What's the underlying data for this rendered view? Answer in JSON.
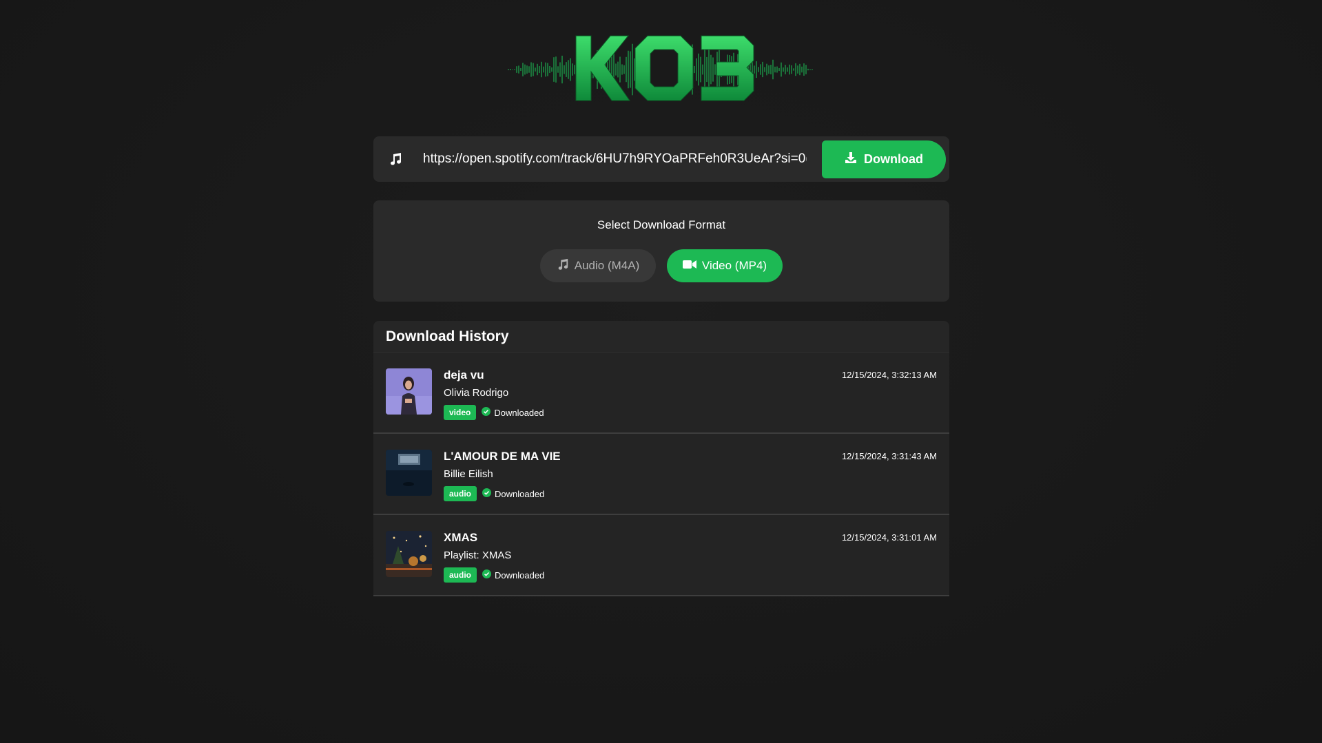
{
  "logo": {
    "text": "KO3",
    "color": "#1db954"
  },
  "search": {
    "icon": "music-note-icon",
    "value": "https://open.spotify.com/track/6HU7h9RYOaPRFeh0R3UeAr?si=0(",
    "button_label": "Download",
    "button_icon": "download-icon"
  },
  "format": {
    "title": "Select Download Format",
    "options": [
      {
        "label": "Audio (M4A)",
        "icon": "music-note-icon",
        "selected": false
      },
      {
        "label": "Video (MP4)",
        "icon": "video-camera-icon",
        "selected": true
      }
    ]
  },
  "history": {
    "title": "Download History",
    "items": [
      {
        "title": "deja vu",
        "subtitle": "Olivia Rodrigo",
        "type": "video",
        "status": "Downloaded",
        "time": "12/15/2024, 3:32:13 AM"
      },
      {
        "title": "L'AMOUR DE MA VIE",
        "subtitle": "Billie Eilish",
        "type": "audio",
        "status": "Downloaded",
        "time": "12/15/2024, 3:31:43 AM"
      },
      {
        "title": "XMAS",
        "subtitle": "Playlist: XMAS",
        "type": "audio",
        "status": "Downloaded",
        "time": "12/15/2024, 3:31:01 AM"
      }
    ]
  },
  "colors": {
    "accent": "#1db954",
    "background": "#1a1a1a",
    "panel": "#2a2a2a"
  }
}
